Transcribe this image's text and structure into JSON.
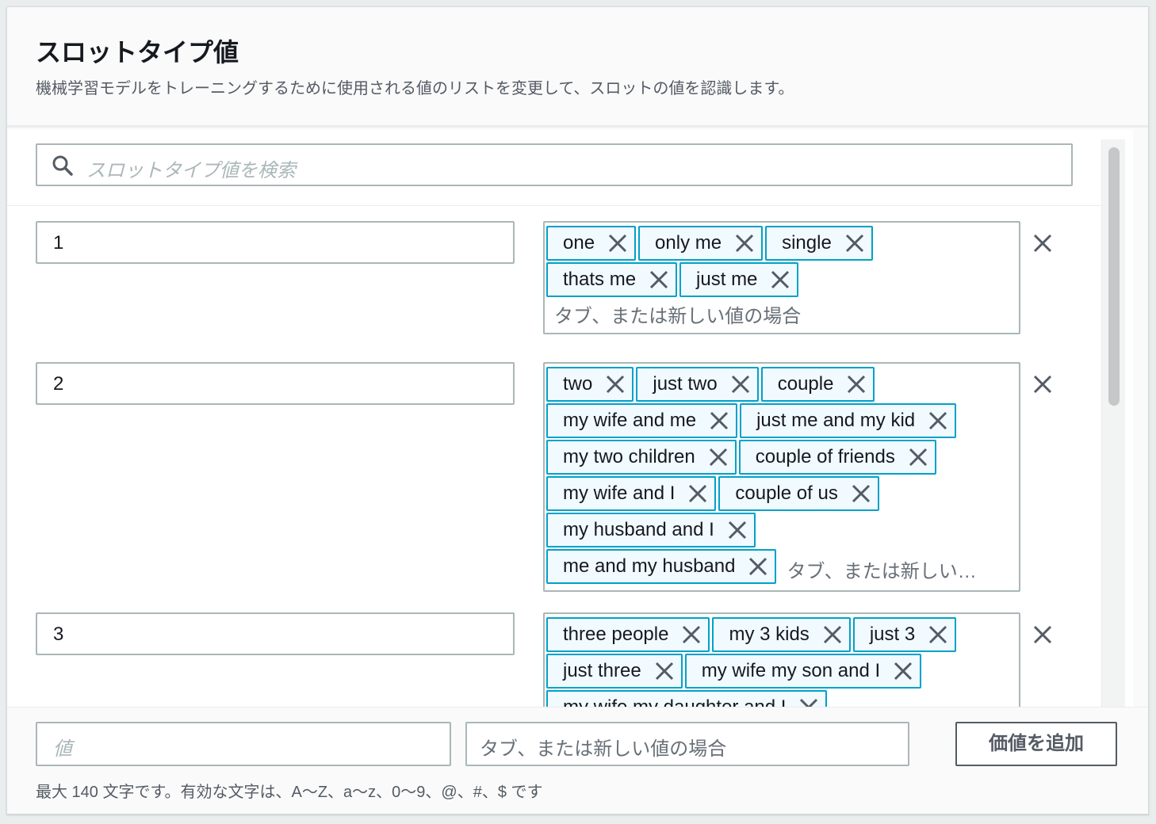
{
  "header": {
    "title": "スロットタイプ値",
    "description": "機械学習モデルをトレーニングするために使用される値のリストを変更して、スロットの値を認識します。"
  },
  "search": {
    "placeholder": "スロットタイプ値を検索"
  },
  "rows": [
    {
      "value": "1",
      "synonym_lines": [
        [
          "one",
          "only me",
          "single"
        ],
        [
          "thats me",
          "just me"
        ]
      ],
      "placeholder": "タブ、または新しい値の場合"
    },
    {
      "value": "2",
      "synonym_lines": [
        [
          "two",
          "just two",
          "couple"
        ],
        [
          "my wife and me",
          "just me and my kid"
        ],
        [
          "my two children",
          "couple of friends"
        ],
        [
          "my wife and I",
          "couple of us"
        ],
        [
          "my husband and I"
        ],
        [
          "me and my husband"
        ]
      ],
      "placeholder": "タブ、または新しい…"
    },
    {
      "value": "3",
      "synonym_lines": [
        [
          "three people",
          "my 3 kids",
          "just 3"
        ],
        [
          "just three",
          "my wife my son and I"
        ],
        [
          "my wife my daughter and I"
        ]
      ]
    }
  ],
  "footer": {
    "value_placeholder": "値",
    "synonym_placeholder": "タブ、または新しい値の場合",
    "add_button": "価値を追加",
    "hint": "最大 140 文字です。有効な文字は、A〜Z、a〜z、0〜9、@、#、$ です"
  },
  "icons": {
    "search": "search-icon",
    "remove": "close-icon"
  },
  "colors": {
    "token_border": "#00a1c9",
    "token_bg": "#f1faff"
  }
}
